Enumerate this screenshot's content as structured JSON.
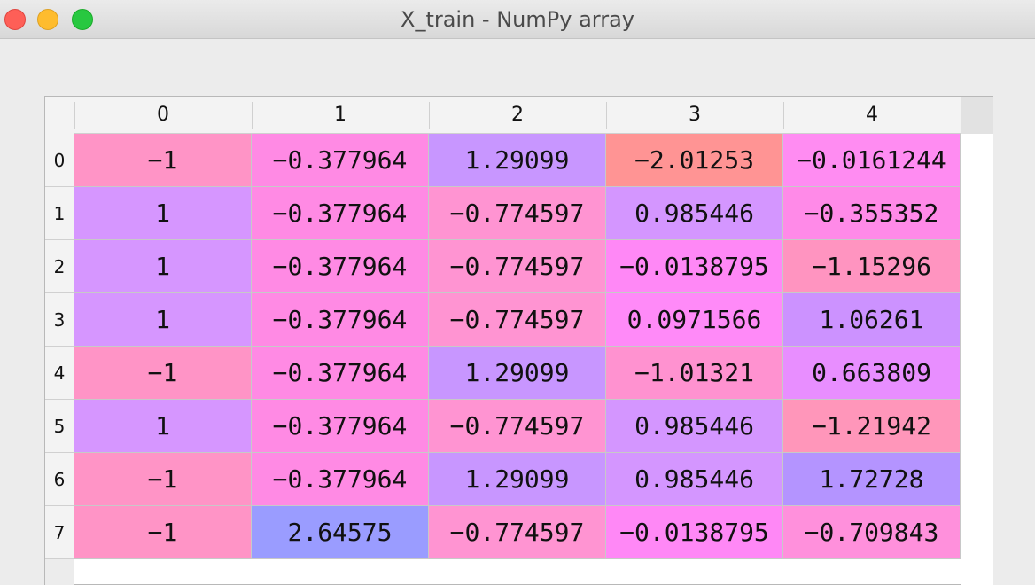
{
  "window": {
    "title": "X_train - NumPy array"
  },
  "table": {
    "columns": [
      "0",
      "1",
      "2",
      "3",
      "4"
    ],
    "rows": [
      {
        "index": "0",
        "cells": [
          {
            "value": "−1",
            "color": "#ff94c6"
          },
          {
            "value": "−0.377964",
            "color": "#ff8ae4"
          },
          {
            "value": "1.29099",
            "color": "#c896ff"
          },
          {
            "value": "−2.01253",
            "color": "#ff9494"
          },
          {
            "value": "−0.0161244",
            "color": "#ff8cf2"
          }
        ]
      },
      {
        "index": "1",
        "cells": [
          {
            "value": "1",
            "color": "#d696ff"
          },
          {
            "value": "−0.377964",
            "color": "#ff8ae4"
          },
          {
            "value": "−0.774597",
            "color": "#ff94d2"
          },
          {
            "value": "0.985446",
            "color": "#d496ff"
          },
          {
            "value": "−0.355352",
            "color": "#ff8ae8"
          }
        ]
      },
      {
        "index": "2",
        "cells": [
          {
            "value": "1",
            "color": "#d696ff"
          },
          {
            "value": "−0.377964",
            "color": "#ff8ae4"
          },
          {
            "value": "−0.774597",
            "color": "#ff94d2"
          },
          {
            "value": "−0.0138795",
            "color": "#ff88f6"
          },
          {
            "value": "−1.15296",
            "color": "#ff94c0"
          }
        ]
      },
      {
        "index": "3",
        "cells": [
          {
            "value": "1",
            "color": "#d696ff"
          },
          {
            "value": "−0.377964",
            "color": "#ff8ae4"
          },
          {
            "value": "−0.774597",
            "color": "#ff94d2"
          },
          {
            "value": "0.0971566",
            "color": "#ff8af8"
          },
          {
            "value": "1.06261",
            "color": "#cc92ff"
          }
        ]
      },
      {
        "index": "4",
        "cells": [
          {
            "value": "−1",
            "color": "#ff94c6"
          },
          {
            "value": "−0.377964",
            "color": "#ff8ae4"
          },
          {
            "value": "1.29099",
            "color": "#c896ff"
          },
          {
            "value": "−1.01321",
            "color": "#ff92d0"
          },
          {
            "value": "0.663809",
            "color": "#e88eff"
          }
        ]
      },
      {
        "index": "5",
        "cells": [
          {
            "value": "1",
            "color": "#d696ff"
          },
          {
            "value": "−0.377964",
            "color": "#ff8ae4"
          },
          {
            "value": "−0.774597",
            "color": "#ff94d2"
          },
          {
            "value": "0.985446",
            "color": "#d496ff"
          },
          {
            "value": "−1.21942",
            "color": "#ff96ba"
          }
        ]
      },
      {
        "index": "6",
        "cells": [
          {
            "value": "−1",
            "color": "#ff94c6"
          },
          {
            "value": "−0.377964",
            "color": "#ff8ae4"
          },
          {
            "value": "1.29099",
            "color": "#c896ff"
          },
          {
            "value": "0.985446",
            "color": "#d496ff"
          },
          {
            "value": "1.72728",
            "color": "#b494ff"
          }
        ]
      },
      {
        "index": "7",
        "cells": [
          {
            "value": "−1",
            "color": "#ff94c6"
          },
          {
            "value": "2.64575",
            "color": "#9a9cff"
          },
          {
            "value": "−0.774597",
            "color": "#ff94d2"
          },
          {
            "value": "−0.0138795",
            "color": "#ff88f6"
          },
          {
            "value": "−0.709843",
            "color": "#ff90dc"
          }
        ]
      }
    ]
  }
}
